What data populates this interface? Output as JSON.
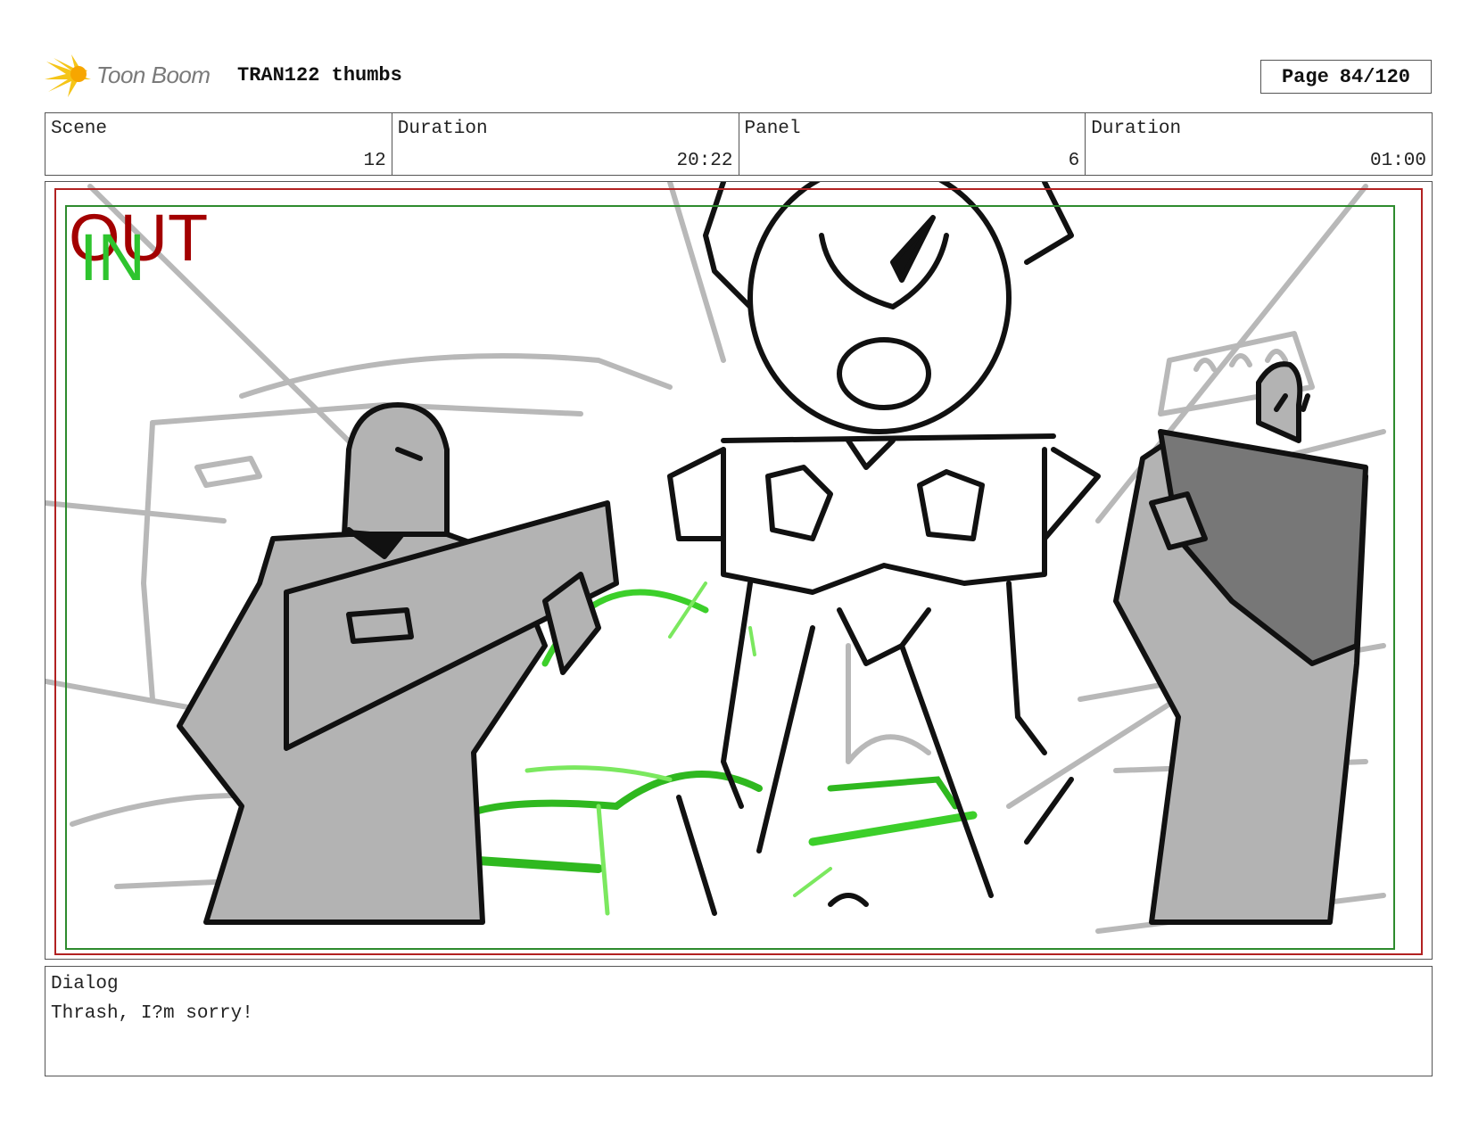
{
  "header": {
    "logo_text": "Toon Boom",
    "project_title": "TRAN122 thumbs",
    "page_label": "Page",
    "page_value": "84/120"
  },
  "info": [
    {
      "label": "Scene",
      "value": "12"
    },
    {
      "label": "Duration",
      "value": "20:22"
    },
    {
      "label": "Panel",
      "value": "6"
    },
    {
      "label": "Duration",
      "value": "01:00"
    }
  ],
  "panel": {
    "out_label": "OUT",
    "in_label": "IN",
    "colors": {
      "out_frame": "#b22222",
      "in_frame": "#2e8b2e",
      "energy": "#3ccf2a",
      "figure_fill": "#b3b3b3",
      "background_sketch": "#b8b8b8"
    }
  },
  "dialog": {
    "label": "Dialog",
    "text": "Thrash, I?m sorry!"
  },
  "icons": {
    "logo": "starburst-logo-icon"
  }
}
